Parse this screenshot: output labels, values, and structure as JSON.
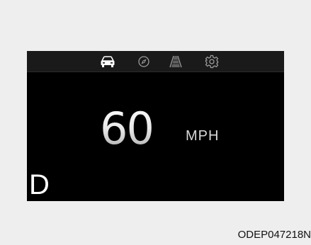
{
  "tabs": [
    {
      "icon": "car-icon",
      "active": true
    },
    {
      "icon": "compass-icon",
      "active": false
    },
    {
      "icon": "road-lane-icon",
      "active": false
    },
    {
      "icon": "settings-gear-icon",
      "active": false
    }
  ],
  "speed": {
    "value": "60",
    "unit": "MPH"
  },
  "gear_indicator": "D",
  "caption": "ODEP047218N",
  "colors": {
    "background": "#eeeeee",
    "display": "#000000",
    "tab_bar": "#1a1a1a",
    "active_icon": "#ffffff",
    "inactive_icon": "#9a9a9a"
  }
}
